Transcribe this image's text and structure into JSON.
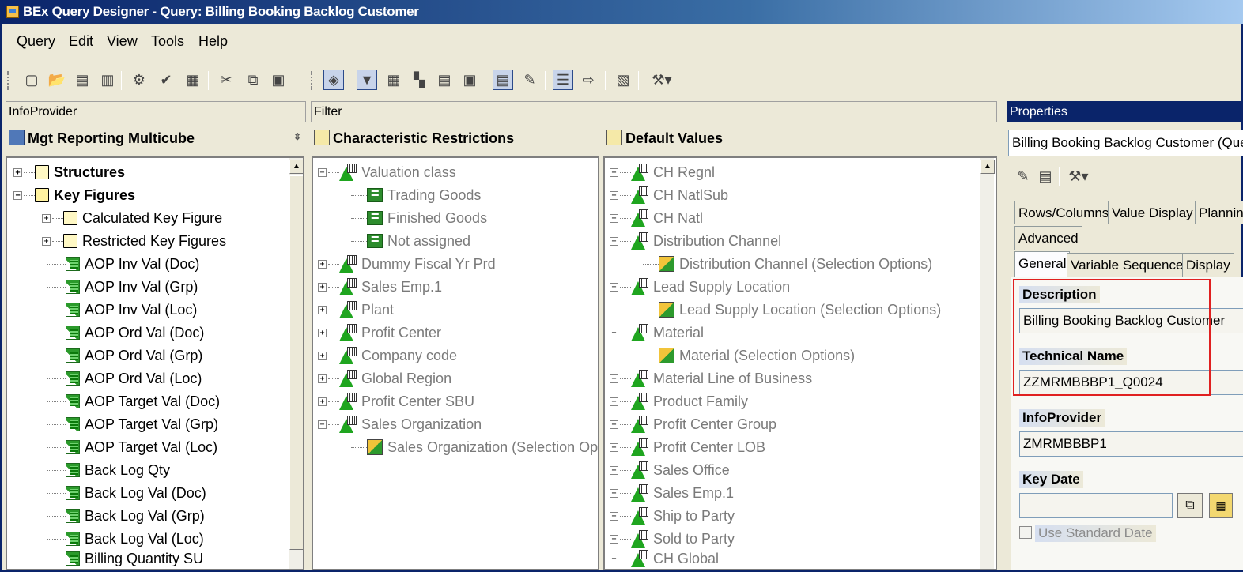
{
  "window": {
    "title": "BEx Query Designer - Query: Billing Booking Backlog Customer"
  },
  "menu": [
    "Query",
    "Edit",
    "View",
    "Tools",
    "Help"
  ],
  "infoprovider": {
    "panel_title": "InfoProvider",
    "header": "Mgt Reporting Multicube",
    "items": [
      {
        "label": "Structures"
      },
      {
        "label": "Key Figures"
      },
      {
        "label": "Calculated Key Figure"
      },
      {
        "label": "Restricted Key Figures"
      },
      {
        "label": "AOP Inv Val (Doc)"
      },
      {
        "label": "AOP Inv Val (Grp)"
      },
      {
        "label": "AOP Inv Val (Loc)"
      },
      {
        "label": "AOP Ord Val (Doc)"
      },
      {
        "label": "AOP Ord Val (Grp)"
      },
      {
        "label": "AOP Ord Val (Loc)"
      },
      {
        "label": "AOP Target Val (Doc)"
      },
      {
        "label": "AOP Target Val (Grp)"
      },
      {
        "label": "AOP Target Val (Loc)"
      },
      {
        "label": "Back Log Qty"
      },
      {
        "label": "Back Log Val (Doc)"
      },
      {
        "label": "Back Log Val (Grp)"
      },
      {
        "label": "Back Log Val (Loc)"
      },
      {
        "label": "Billing Quantity SU"
      }
    ]
  },
  "filter": {
    "panel_title": "Filter",
    "restrictions_header": "Characteristic Restrictions",
    "defaults_header": "Default Values",
    "restrictions": [
      {
        "label": "Valuation class"
      },
      {
        "label": "Trading Goods"
      },
      {
        "label": "Finished Goods"
      },
      {
        "label": "Not assigned"
      },
      {
        "label": "Dummy Fiscal Yr Prd"
      },
      {
        "label": "Sales Emp.1"
      },
      {
        "label": "Plant"
      },
      {
        "label": "Profit Center"
      },
      {
        "label": "Company code"
      },
      {
        "label": "Global Region"
      },
      {
        "label": "Profit Center SBU"
      },
      {
        "label": "Sales Organization"
      },
      {
        "label": "Sales Organization (Selection Options)"
      }
    ],
    "defaults": [
      {
        "label": "CH Regnl"
      },
      {
        "label": "CH NatlSub"
      },
      {
        "label": "CH Natl"
      },
      {
        "label": "Distribution Channel"
      },
      {
        "label": "Distribution Channel (Selection Options)"
      },
      {
        "label": "Lead Supply Location"
      },
      {
        "label": "Lead Supply Location (Selection Options)"
      },
      {
        "label": "Material"
      },
      {
        "label": "Material (Selection Options)"
      },
      {
        "label": "Material Line of Business"
      },
      {
        "label": "Product Family"
      },
      {
        "label": "Profit Center Group"
      },
      {
        "label": "Profit Center LOB"
      },
      {
        "label": "Sales Office"
      },
      {
        "label": "Sales Emp.1"
      },
      {
        "label": "Ship to Party"
      },
      {
        "label": "Sold to Party"
      },
      {
        "label": "CH Global"
      }
    ]
  },
  "properties": {
    "panel_title": "Properties",
    "selector": "Billing Booking Backlog Customer (Query)",
    "tabs_row1": [
      "Rows/Columns",
      "Value Display",
      "Plannin"
    ],
    "tabs_row2": [
      "Advanced"
    ],
    "tabs_row3": [
      "General",
      "Variable Sequence",
      "Display"
    ],
    "description_label": "Description",
    "description_value": "Billing Booking Backlog Customer",
    "technical_name_label": "Technical Name",
    "technical_name_value": "ZZMRMBBBP1_Q0024",
    "infoprovider_label": "InfoProvider",
    "infoprovider_value": "ZMRMBBBP1",
    "key_date_label": "Key Date",
    "key_date_value": "",
    "use_standard_date_label": "Use Standard Date"
  }
}
